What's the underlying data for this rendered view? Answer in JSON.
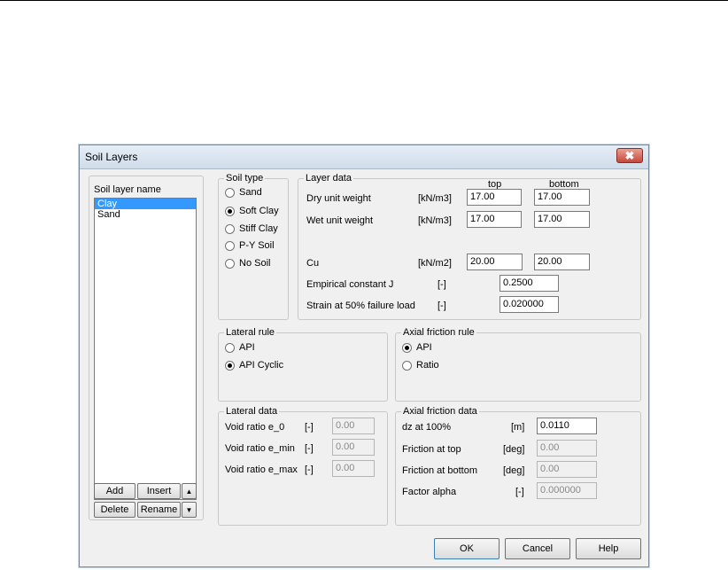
{
  "window": {
    "title": "Soil Layers",
    "close_glyph": "✖"
  },
  "layers": {
    "label": "Soil layer name",
    "items": [
      "Clay",
      "Sand"
    ],
    "selected": "Clay",
    "buttons": {
      "add": "Add",
      "insert": "Insert",
      "up": "▲",
      "delete": "Delete",
      "rename": "Rename",
      "down": "▼"
    }
  },
  "soil_type": {
    "label": "Soil type",
    "options": [
      "Sand",
      "Soft Clay",
      "Stiff Clay",
      "P-Y Soil",
      "No Soil"
    ],
    "selected": "Soft Clay"
  },
  "layer_data": {
    "label": "Layer data",
    "col_top": "top",
    "col_bottom": "bottom",
    "rows": [
      {
        "label": "Dry unit weight",
        "unit": "[kN/m3]",
        "top": "17.00",
        "bottom": "17.00"
      },
      {
        "label": "Wet unit weight",
        "unit": "[kN/m3]",
        "top": "17.00",
        "bottom": "17.00"
      },
      {
        "label": "Cu",
        "unit": "[kN/m2]",
        "top": "20.00",
        "bottom": "20.00"
      }
    ],
    "empirical_label": "Empirical constant J",
    "empirical_unit": "[-]",
    "empirical_value": "0.2500",
    "strain_label": "Strain at 50% failure load",
    "strain_unit": "[-]",
    "strain_value": "0.020000"
  },
  "lateral_rule": {
    "label": "Lateral rule",
    "options": [
      "API",
      "API Cyclic"
    ],
    "selected": "API Cyclic"
  },
  "axial_rule": {
    "label": "Axial friction rule",
    "options": [
      "API",
      "Ratio"
    ],
    "selected": "API"
  },
  "lateral_data": {
    "label": "Lateral data",
    "rows": [
      {
        "label": "Void ratio e_0",
        "unit": "[-]",
        "value": "0.00"
      },
      {
        "label": "Void ratio e_min",
        "unit": "[-]",
        "value": "0.00"
      },
      {
        "label": "Void ratio e_max",
        "unit": "[-]",
        "value": "0.00"
      }
    ]
  },
  "axial_data": {
    "label": "Axial friction data",
    "rows": [
      {
        "label": "dz at 100%",
        "unit": "[m]",
        "value": "0.0110"
      },
      {
        "label": "Friction at top",
        "unit": "[deg]",
        "value": "0.00"
      },
      {
        "label": "Friction at bottom",
        "unit": "[deg]",
        "value": "0.00"
      },
      {
        "label": "Factor alpha",
        "unit": "[-]",
        "value": "0.000000"
      }
    ]
  },
  "footer": {
    "ok": "OK",
    "cancel": "Cancel",
    "help": "Help"
  }
}
